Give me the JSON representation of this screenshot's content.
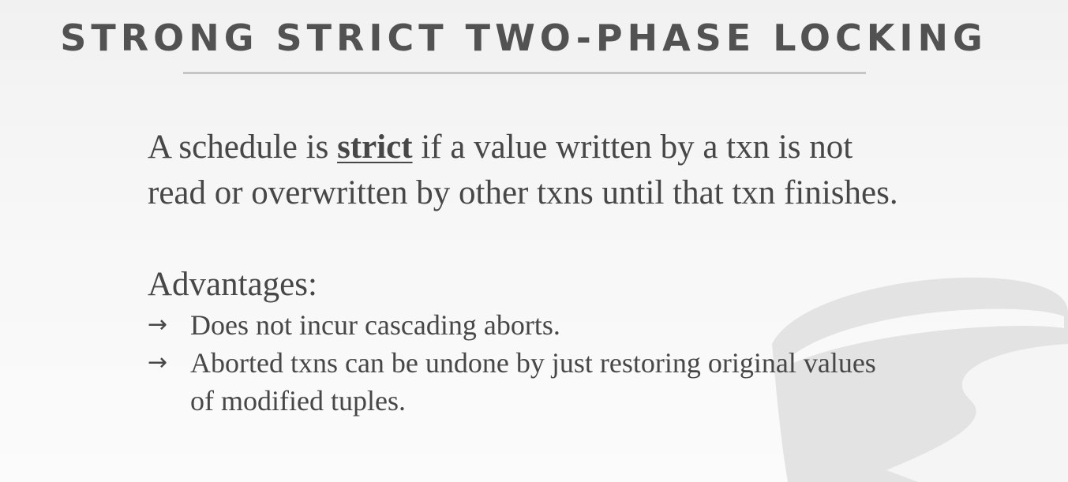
{
  "slide": {
    "title": "STRONG STRICT TWO-PHASE LOCKING",
    "definition": {
      "before": "A schedule is ",
      "term": "strict",
      "after": " if a value written by a txn is not read or overwritten by other txns until that txn finishes."
    },
    "advantages_heading": "Advantages:",
    "bullet_icon": "arrow-right-icon",
    "advantages": [
      "Does not incur cascading aborts.",
      "Aborted txns can be undone by just restoring original values of modified tuples."
    ]
  },
  "colors": {
    "text": "#474747",
    "title": "#525252",
    "rule": "#c5c5c5",
    "watermark": "#e3e3e3"
  }
}
